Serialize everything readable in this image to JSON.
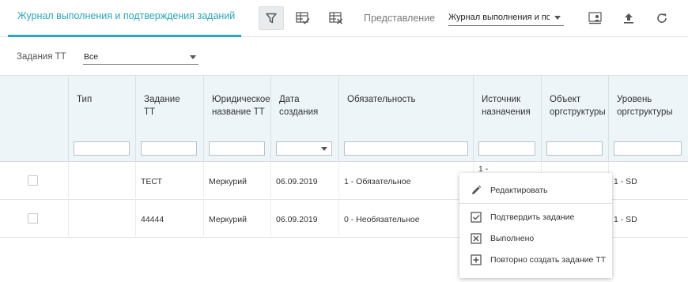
{
  "toolbar": {
    "active_tab": "Журнал выполнения и подтверждения заданий",
    "view_label": "Представление",
    "view_value": "Журнал выполнения и подтв"
  },
  "filter": {
    "label": "Задания ТТ",
    "value": "Все"
  },
  "columns": [
    {
      "title": ""
    },
    {
      "title": "Тип"
    },
    {
      "title": "Задание\nТТ"
    },
    {
      "title": "Юридическое\nназвание ТТ"
    },
    {
      "title": "Дата\nсоздания"
    },
    {
      "title": "Обязательность"
    },
    {
      "title": "Источник\nназначения"
    },
    {
      "title": "Объект\nоргструктуры"
    },
    {
      "title": "Уровень\nоргструктуры"
    }
  ],
  "rows": [
    {
      "type": "",
      "task": "ТЕСТ",
      "legal_name": "Меркурий",
      "created": "06.09.2019",
      "mandatory": "1 - Обязательное",
      "source": "1 -",
      "org_object": "",
      "org_level": "1 - SD"
    },
    {
      "type": "",
      "task": "44444",
      "legal_name": "Меркурий",
      "created": "06.09.2019",
      "mandatory": "0 - Необязательное",
      "source": "",
      "org_object": "",
      "org_level": "1 - SD"
    }
  ],
  "context_menu": {
    "edit": "Редактировать",
    "confirm": "Подтвердить задание",
    "done": "Выполнено",
    "recreate": "Повторно создать задание ТТ"
  },
  "colors": {
    "accent": "#2aa6b7",
    "header_bg": "#eef5f8"
  }
}
